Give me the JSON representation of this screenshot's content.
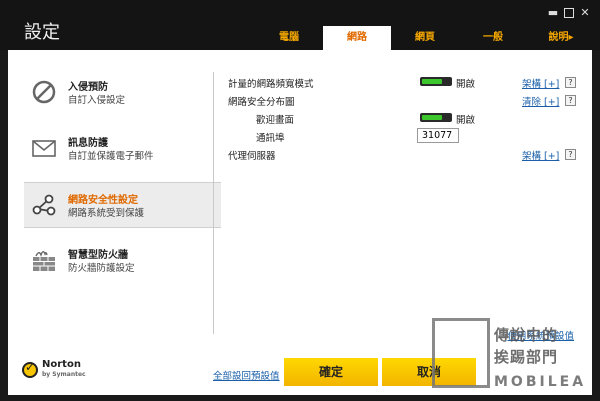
{
  "window": {
    "title": "設定"
  },
  "tabs": [
    {
      "label": "電腦",
      "active": false
    },
    {
      "label": "網路",
      "active": true
    },
    {
      "label": "網頁",
      "active": false
    },
    {
      "label": "一般",
      "active": false
    },
    {
      "label": "說明▸",
      "active": false
    }
  ],
  "sidebar": {
    "items": [
      {
        "title": "入侵預防",
        "subtitle": "自訂入侵設定",
        "icon": "no-entry-icon",
        "active": false
      },
      {
        "title": "訊息防護",
        "subtitle": "自訂並保護電子郵件",
        "icon": "envelope-icon",
        "active": false
      },
      {
        "title": "網路安全性設定",
        "subtitle": "網路系統受到保護",
        "icon": "network-nodes-icon",
        "active": true
      },
      {
        "title": "智慧型防火牆",
        "subtitle": "防火牆防護設定",
        "icon": "firewall-icon",
        "active": false
      }
    ]
  },
  "settings": {
    "bandwidth": {
      "label": "計量的網路頻寬模式",
      "state": "開啟",
      "link": "架構 [+]",
      "help": "?"
    },
    "security_map": {
      "label": "網路安全分布圖",
      "link": "清除 [+]",
      "help": "?"
    },
    "welcome": {
      "label": "歡迎畫面",
      "state": "開啟"
    },
    "port": {
      "label": "通訊埠",
      "value": "31077"
    },
    "proxy": {
      "label": "代理伺服器",
      "link": "架構 [+]",
      "help": "?"
    }
  },
  "footer": {
    "defaults_link": "使用系統預設值",
    "restore_link": "全部設回預設值",
    "ok_label": "確定",
    "cancel_label": "取消",
    "logo": {
      "name": "Norton",
      "sub": "by Symantec"
    }
  },
  "watermark": {
    "line1": "傳說中的",
    "line2": "挨踢部門",
    "line3": "MOBILEA"
  },
  "colors": {
    "accent": "#f6a800",
    "active_text": "#e06a00",
    "link": "#1a5fa8",
    "toggle_on": "#3cc72c",
    "button": "#ffd200"
  }
}
